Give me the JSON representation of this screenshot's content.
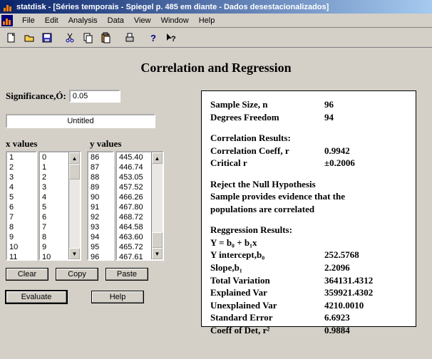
{
  "window": {
    "title": "statdisk - [Séries temporais - Spiegel p. 485 em diante -  Dados desestacionalizados]"
  },
  "menu": {
    "items": [
      "File",
      "Edit",
      "Analysis",
      "Data",
      "View",
      "Window",
      "Help"
    ]
  },
  "toolbar": {
    "icons": [
      "new-icon",
      "open-icon",
      "save-icon",
      "cut-icon",
      "copy-icon",
      "paste-icon",
      "print-icon",
      "help-icon",
      "whatsthis-icon"
    ]
  },
  "page": {
    "title": "Correlation and Regression"
  },
  "inputs": {
    "significance_label": "Significance,Ó:",
    "significance_value": "0.05",
    "untitled": "Untitled"
  },
  "columns": {
    "x_header": "x values",
    "y_header": "y values",
    "idx": [
      "1",
      "2",
      "3",
      "4",
      "5",
      "6",
      "7",
      "8",
      "9",
      "10",
      "11"
    ],
    "xvals": [
      "0",
      "1",
      "2",
      "3",
      "4",
      "5",
      "6",
      "7",
      "8",
      "9",
      "10"
    ],
    "yidx": [
      "86",
      "87",
      "88",
      "89",
      "90",
      "91",
      "92",
      "93",
      "94",
      "95",
      "96"
    ],
    "yvals": [
      "445.40",
      "446.74",
      "453.05",
      "457.52",
      "466.26",
      "467.80",
      "468.72",
      "464.58",
      "463.60",
      "465.72",
      "467.61"
    ]
  },
  "buttons": {
    "clear": "Clear",
    "copy": "Copy",
    "paste": "Paste",
    "evaluate": "Evaluate",
    "help": "Help"
  },
  "results": {
    "sample_size_k": "Sample Size, n",
    "sample_size_v": "96",
    "df_k": "Degrees Freedom",
    "df_v": "94",
    "corr_header": "Correlation Results:",
    "corr_coeff_k": "Correlation Coeff, r",
    "corr_coeff_v": "0.9942",
    "crit_r_k": "Critical r",
    "crit_r_v": "±0.2006",
    "reject": "Reject the Null Hypothesis",
    "evidence1": "Sample provides evidence that the",
    "evidence2": "populations are correlated",
    "reg_header": "Reggression Results:",
    "eq": "Y = b₀ + b₁x",
    "yint_k": "Y intercept,b₀",
    "yint_v": "252.5768",
    "slope_k": "Slope,b₁",
    "slope_v": "2.2096",
    "totvar_k": "Total Variation",
    "totvar_v": "364131.4312",
    "expvar_k": "Explained Var",
    "expvar_v": "359921.4302",
    "unexpvar_k": "Unexplained Var",
    "unexpvar_v": "4210.0010",
    "stderr_k": "Standard Error",
    "stderr_v": "6.6923",
    "coefdet_k": "Coeff of Det, r²",
    "coefdet_v": "0.9884"
  }
}
